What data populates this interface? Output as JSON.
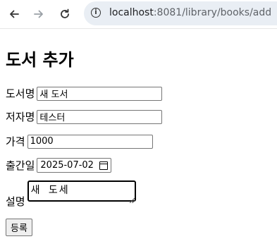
{
  "browser": {
    "url_host": "localhost",
    "url_rest": ":8081/library/books/add"
  },
  "page": {
    "title": "도서 추가",
    "fields": {
      "title_label": "도서명",
      "title_value": "새 도서",
      "author_label": "저자명",
      "author_value": "테스터",
      "price_label": "가격",
      "price_value": "1000",
      "date_label": "출간일",
      "date_value": "2025-07-02",
      "desc_label": "설명",
      "desc_value": "새 도세"
    },
    "submit_label": "등록"
  }
}
